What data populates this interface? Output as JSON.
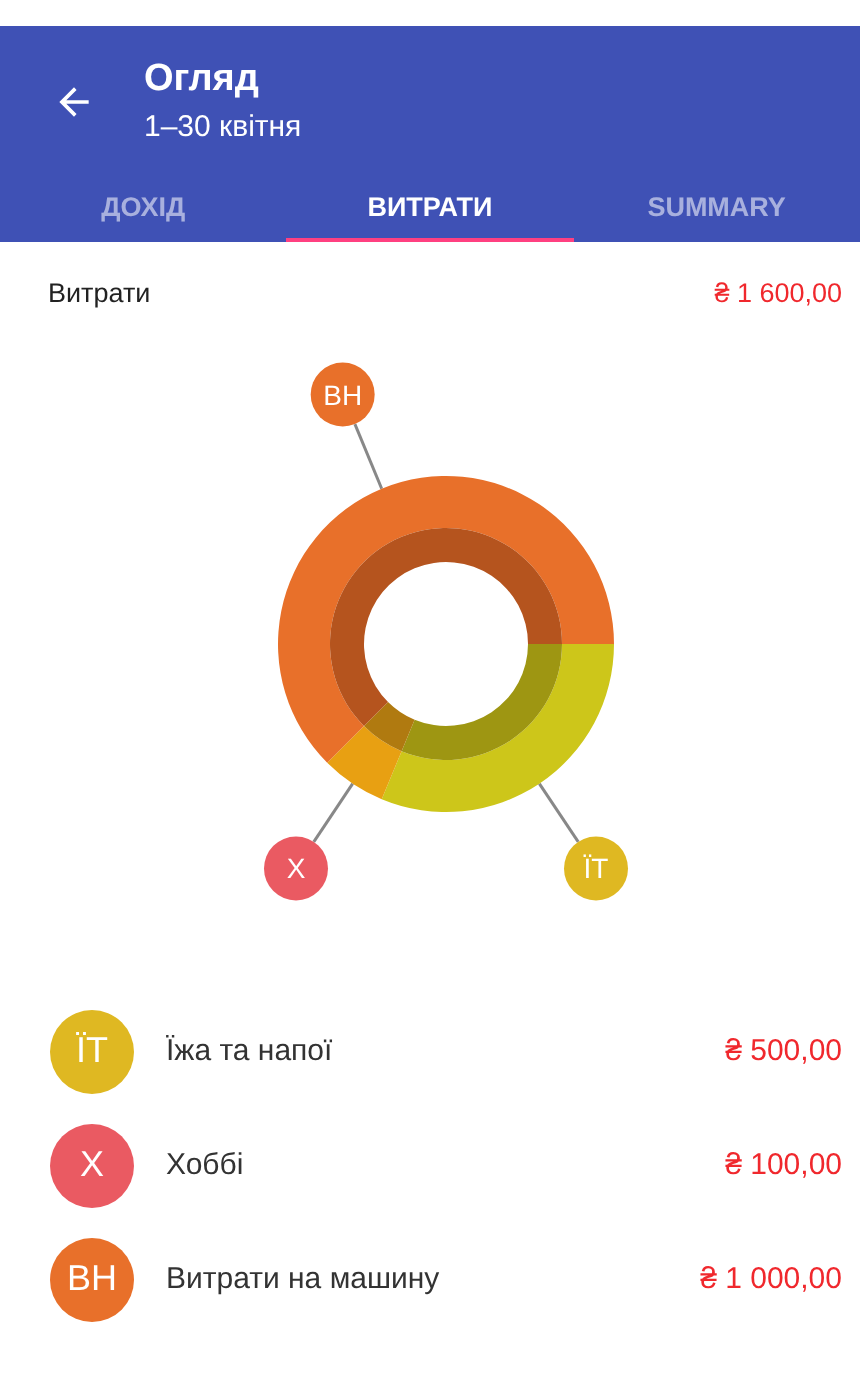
{
  "app_bar": {
    "title": "Огляд",
    "subtitle": "1–30 квітня"
  },
  "tabs": [
    {
      "label": "ДОХІД",
      "selected": false
    },
    {
      "label": "ВИТРАТИ",
      "selected": true
    },
    {
      "label": "SUMMARY",
      "selected": false
    }
  ],
  "summary": {
    "label": "Витрати",
    "amount": "₴ 1 600,00"
  },
  "chart_data": {
    "type": "donut",
    "categories": [
      "ЇТ",
      "Х",
      "ВН"
    ],
    "series": [
      {
        "values": [
          31.25,
          6.25,
          62.5
        ],
        "colors": [
          "#cdc61a",
          "#e8a012",
          "#e8702a"
        ]
      },
      {
        "values": [
          31.25,
          6.25,
          62.5
        ],
        "colors": [
          "#9e9612",
          "#b07a10",
          "#b5541e"
        ]
      }
    ]
  },
  "categories": [
    {
      "initials": "ЇТ",
      "name": "Їжа та напої",
      "amount": "₴ 500,00",
      "color": "#dfb822"
    },
    {
      "initials": "Х",
      "name": "Хоббі",
      "amount": "₴ 100,00",
      "color": "#ea5a62"
    },
    {
      "initials": "ВН",
      "name": "Витрати на машину",
      "amount": "₴ 1 000,00",
      "color": "#e8702a"
    }
  ]
}
